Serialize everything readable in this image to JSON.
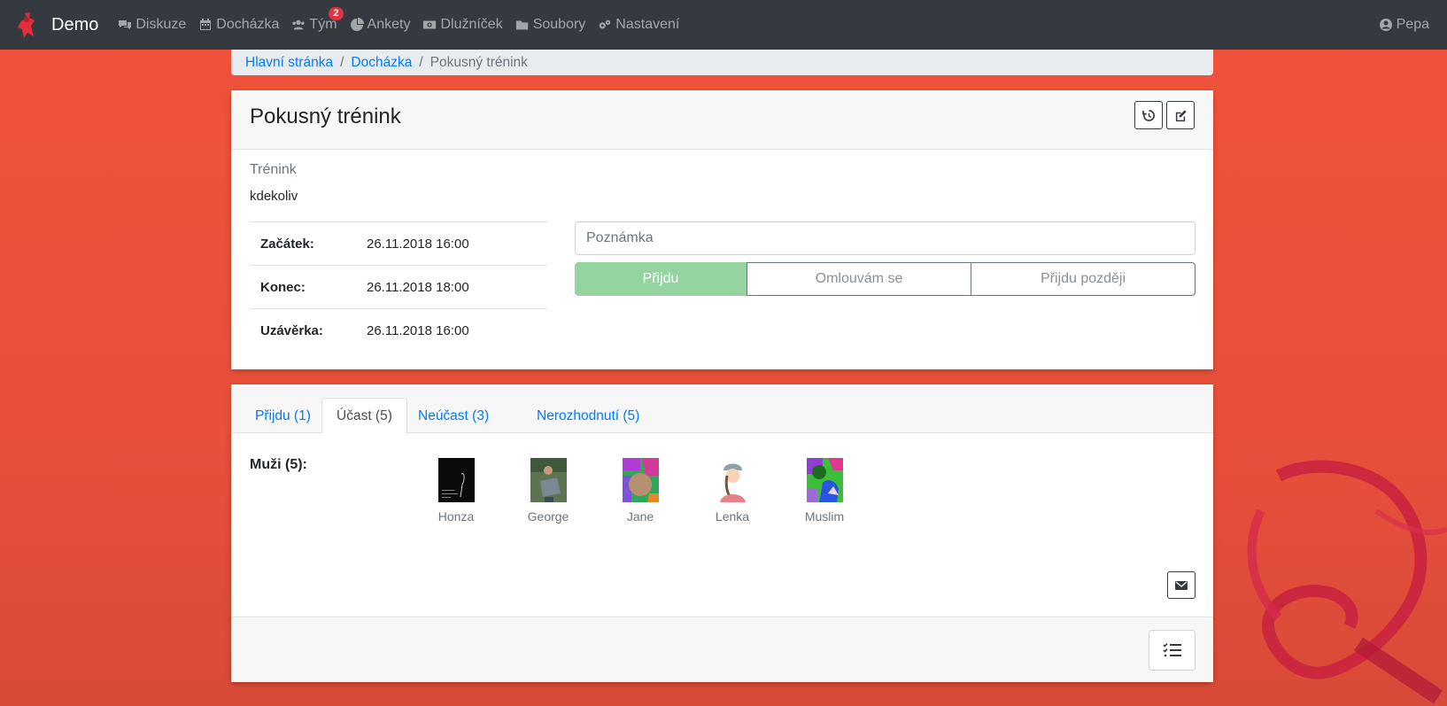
{
  "app": {
    "brand": "Demo"
  },
  "nav": {
    "items": [
      {
        "label": "Diskuze",
        "icon": "comments-icon"
      },
      {
        "label": "Docházka",
        "icon": "calendar-icon"
      },
      {
        "label": "Tým",
        "icon": "users-icon",
        "badge": "2"
      },
      {
        "label": "Ankety",
        "icon": "pie-chart-icon"
      },
      {
        "label": "Dlužníček",
        "icon": "money-icon"
      },
      {
        "label": "Soubory",
        "icon": "folder-icon"
      },
      {
        "label": "Nastavení",
        "icon": "gears-icon"
      }
    ],
    "user": "Pepa"
  },
  "breadcrumb": {
    "home": "Hlavní stránka",
    "section": "Docházka",
    "current": "Pokusný trénink"
  },
  "event": {
    "title": "Pokusný trénink",
    "type": "Trénink",
    "place": "kdekoliv",
    "times": [
      {
        "label": "Začátek:",
        "value": "26.11.2018 16:00"
      },
      {
        "label": "Konec:",
        "value": "26.11.2018 18:00"
      },
      {
        "label": "Uzávěrka:",
        "value": "26.11.2018 16:00"
      }
    ],
    "note_placeholder": "Poznámka",
    "attendance_buttons": {
      "yes": "Přijdu",
      "no": "Omlouvám se",
      "late": "Přijdu později"
    },
    "accent_yes": "#95d3a0"
  },
  "tabs": [
    {
      "label": "Přijdu (1)",
      "active": false
    },
    {
      "label": "Účast (5)",
      "active": true
    },
    {
      "label": "Neúčast (3)",
      "active": false
    },
    {
      "label": "Nerozhodnutí (5)",
      "active": false
    }
  ],
  "participants": {
    "group_label": "Muži (5):",
    "members": [
      "Honza",
      "George",
      "Jane",
      "Lenka",
      "Muslim"
    ]
  }
}
